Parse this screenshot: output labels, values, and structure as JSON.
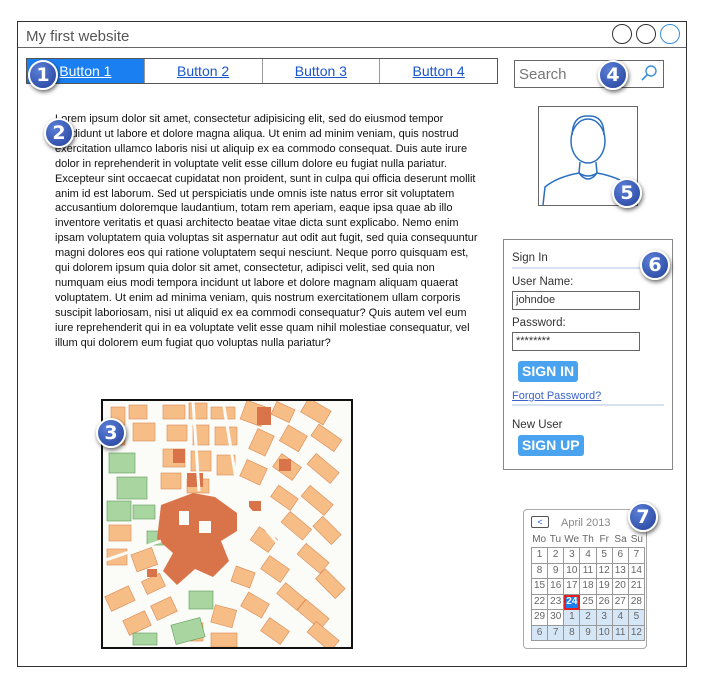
{
  "window": {
    "title": "My first website"
  },
  "nav": {
    "buttons": [
      "Button 1",
      "Button 2",
      "Button 3",
      "Button 4"
    ]
  },
  "search": {
    "placeholder": "Search"
  },
  "annotations": [
    "1",
    "2",
    "3",
    "4",
    "5",
    "6",
    "7"
  ],
  "content": {
    "text": "Lorem ipsum dolor sit amet, consectetur adipisicing elit, sed do eiusmod tempor incididunt ut labore et dolore magna aliqua. Ut enim ad minim veniam, quis nostrud exercitation ullamco laboris nisi ut aliquip ex ea commodo consequat. Duis aute irure dolor in reprehenderit in voluptate velit esse cillum dolore eu fugiat nulla pariatur. Excepteur sint occaecat cupidatat non proident, sunt in culpa qui officia deserunt mollit anim id est laborum. Sed ut perspiciatis unde omnis iste natus error sit voluptatem accusantium doloremque laudantium, totam rem aperiam, eaque ipsa quae ab illo inventore veritatis et quasi architecto beatae vitae dicta sunt explicabo. Nemo enim ipsam voluptatem quia voluptas sit aspernatur aut odit aut fugit, sed quia consequuntur magni dolores eos qui ratione voluptatem sequi nesciunt. Neque porro quisquam est, qui dolorem ipsum quia dolor sit amet, consectetur, adipisci velit, sed quia non numquam eius modi tempora incidunt ut labore et dolore magnam aliquam quaerat voluptatem. Ut enim ad minima veniam, quis nostrum exercitationem ullam corporis suscipit laboriosam, nisi ut aliquid ex ea commodi consequatur? Quis autem vel eum iure reprehenderit qui in ea voluptate velit esse quam nihil molestiae consequatur, vel illum qui dolorem eum fugiat quo voluptas nulla pariatur?"
  },
  "signin": {
    "heading": "Sign In",
    "username_label": "User Name:",
    "username_value": "johndoe",
    "password_label": "Password:",
    "password_value": "********",
    "signin_button": "SIGN IN",
    "forgot_link": "Forgot Password?",
    "new_user_label": "New User",
    "signup_button": "SIGN UP"
  },
  "calendar": {
    "month_label": "April 2013",
    "prev_label": "<",
    "weekdays": [
      "Mo",
      "Tu",
      "We",
      "Th",
      "Fr",
      "Sa",
      "Su"
    ],
    "days": [
      "1",
      "2",
      "3",
      "4",
      "5",
      "6",
      "7",
      "8",
      "9",
      "10",
      "11",
      "12",
      "13",
      "14",
      "15",
      "16",
      "17",
      "18",
      "19",
      "20",
      "21",
      "22",
      "23",
      "24",
      "25",
      "26",
      "27",
      "28",
      "29",
      "30",
      "1",
      "2",
      "3",
      "4",
      "5",
      "6",
      "7",
      "8",
      "9",
      "10",
      "11",
      "12"
    ],
    "selected_day": "24"
  },
  "colors": {
    "accent": "#1a7ff0",
    "badge": "#2f4fb0",
    "map_block": "#f7bd86",
    "map_park": "#a8d5a0",
    "map_center": "#d9744a"
  }
}
